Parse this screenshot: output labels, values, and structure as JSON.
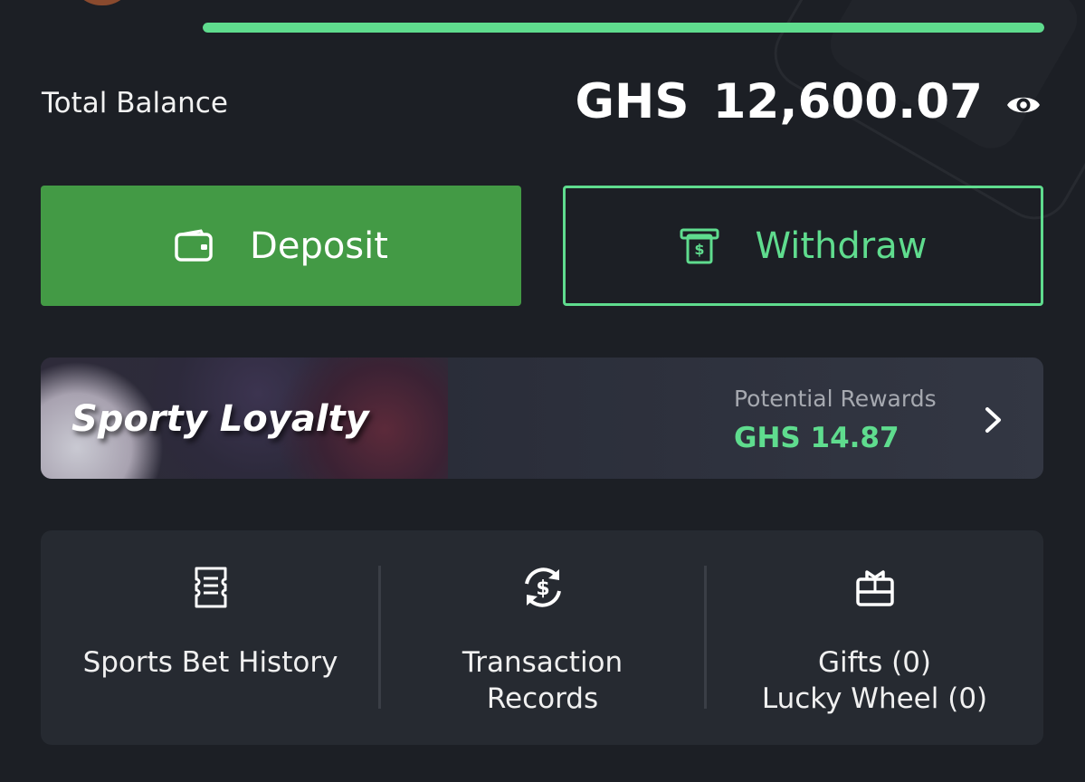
{
  "progress": {
    "percent": 100,
    "color": "#5fdc8e"
  },
  "balance": {
    "label": "Total Balance",
    "currency": "GHS",
    "amount": "12,600.07",
    "visibility_icon": "eye-icon"
  },
  "actions": {
    "deposit": {
      "label": "Deposit",
      "icon": "wallet-icon",
      "color": "#439a45"
    },
    "withdraw": {
      "label": "Withdraw",
      "icon": "cash-withdraw-icon",
      "color": "#5fdc8e"
    }
  },
  "loyalty": {
    "title": "Sporty Loyalty",
    "rewards_label": "Potential Rewards",
    "rewards_value": "GHS 14.87",
    "arrow_icon": "chevron-right-icon"
  },
  "quick_links": [
    {
      "line1": "Sports Bet History",
      "line2": "",
      "icon": "ticket-icon"
    },
    {
      "line1": "Transaction",
      "line2": "Records",
      "icon": "dollar-cycle-icon"
    },
    {
      "line1": "Gifts (0)",
      "line2": "Lucky Wheel (0)",
      "icon": "gift-box-icon"
    }
  ]
}
